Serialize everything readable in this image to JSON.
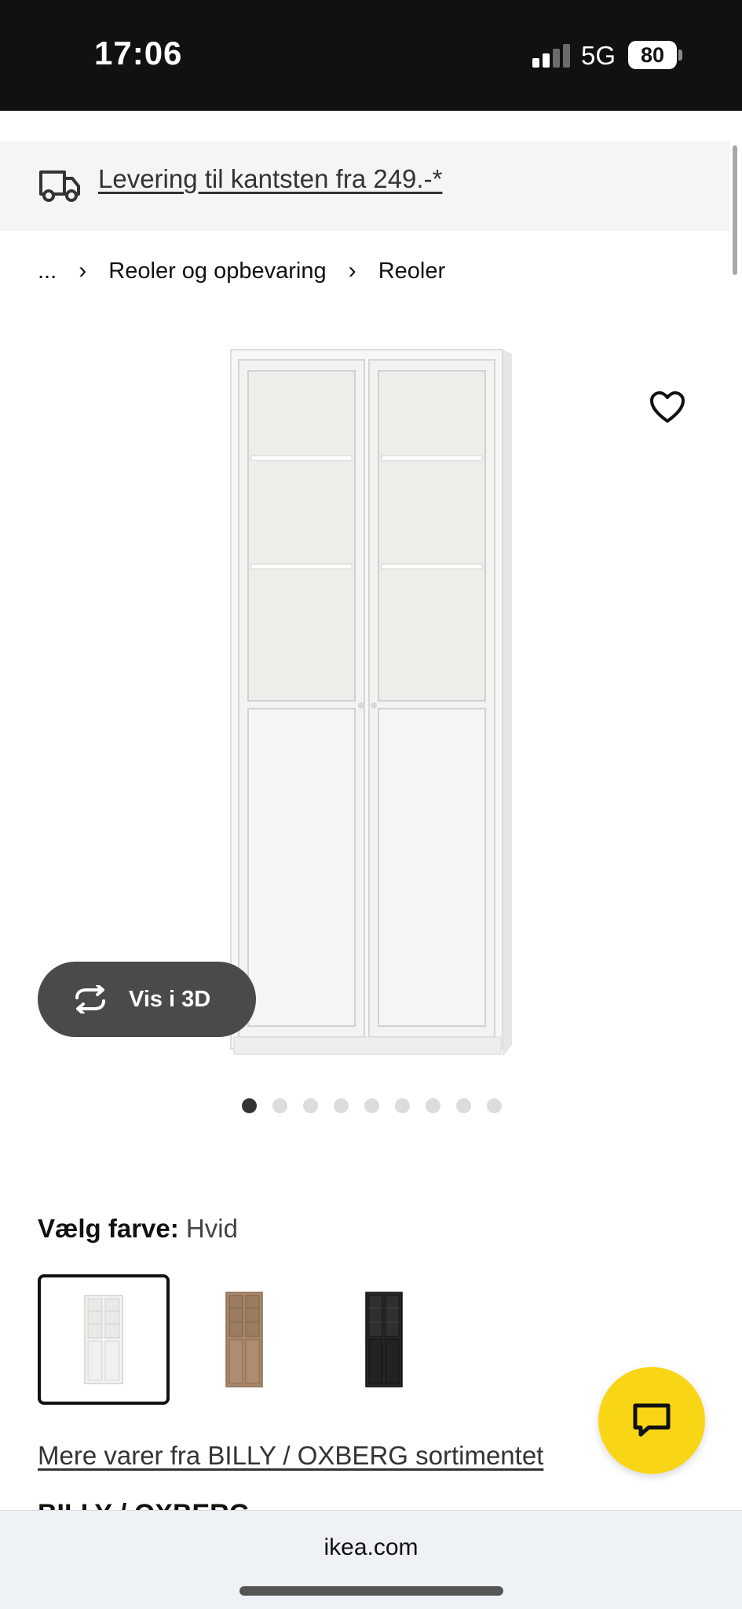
{
  "status_bar": {
    "time": "17:06",
    "network": "5G",
    "battery": "80"
  },
  "delivery_banner": {
    "text": "Levering til kantsten fra 249.-*"
  },
  "breadcrumb": {
    "ellipsis": "...",
    "items": [
      "Reoler og opbevaring",
      "Reoler"
    ],
    "separator": "›"
  },
  "product": {
    "vis3d_label": "Vis i 3D",
    "image_count": 9,
    "active_image": 1
  },
  "color_selector": {
    "label": "Vælg farve:",
    "value": "Hvid",
    "options": [
      "white",
      "oak",
      "black"
    ],
    "selected": "white"
  },
  "range_link": "Mere varer fra BILLY / OXBERG sortimentet",
  "product_title_partial": "BILLY / OXBERG",
  "url_bar": {
    "domain": "ikea.com"
  },
  "colors": {
    "fab": "#f9d615",
    "dark_button": "#4a4a4a",
    "banner_bg": "#f5f5f5"
  }
}
